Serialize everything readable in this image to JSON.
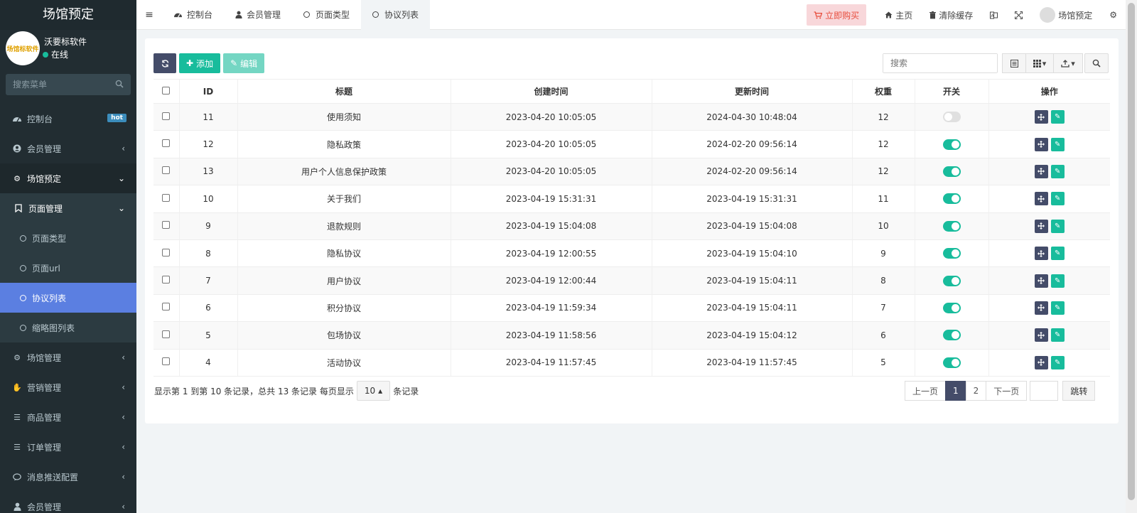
{
  "sidebar": {
    "brand": "场馆预定",
    "user": {
      "name": "沃要标软件",
      "status": "在线",
      "avatar_text": "场馆标软件"
    },
    "search_placeholder": "搜索菜单",
    "items": [
      {
        "label": "控制台",
        "icon": "dashboard-icon",
        "badge": "hot"
      },
      {
        "label": "会员管理",
        "icon": "user-circle-icon"
      },
      {
        "label": "场馆预定",
        "icon": "gear-icon"
      },
      {
        "label": "页面管理",
        "icon": "bookmark-icon"
      },
      {
        "label": "页面类型"
      },
      {
        "label": "页面url"
      },
      {
        "label": "协议列表"
      },
      {
        "label": "缩略图列表"
      },
      {
        "label": "场馆管理",
        "icon": "gear-icon"
      },
      {
        "label": "营销管理",
        "icon": "hand-icon"
      },
      {
        "label": "商品管理",
        "icon": "list-icon"
      },
      {
        "label": "订单管理",
        "icon": "list-icon"
      },
      {
        "label": "消息推送配置",
        "icon": "comment-icon"
      },
      {
        "label": "会员管理",
        "icon": "user-icon"
      }
    ]
  },
  "topbar": {
    "tabs": [
      {
        "label": "控制台"
      },
      {
        "label": "会员管理"
      },
      {
        "label": "页面类型"
      },
      {
        "label": "协议列表"
      }
    ],
    "buy": "立即购买",
    "home": "主页",
    "clear_cache": "清除缓存",
    "user": "场馆预定"
  },
  "toolbar": {
    "add": "添加",
    "edit": "编辑",
    "search_placeholder": "搜索"
  },
  "table": {
    "columns": [
      "ID",
      "标题",
      "创建时间",
      "更新时间",
      "权重",
      "开关",
      "操作"
    ],
    "rows": [
      {
        "id": "11",
        "title": "使用须知",
        "created": "2023-04-20 10:05:05",
        "updated": "2024-04-30 10:48:04",
        "weight": "12",
        "on": false
      },
      {
        "id": "12",
        "title": "隐私政策",
        "created": "2023-04-20 10:05:05",
        "updated": "2024-02-20 09:56:14",
        "weight": "12",
        "on": true
      },
      {
        "id": "13",
        "title": "用户个人信息保护政策",
        "created": "2023-04-20 10:05:05",
        "updated": "2024-02-20 09:56:14",
        "weight": "12",
        "on": true
      },
      {
        "id": "10",
        "title": "关于我们",
        "created": "2023-04-19 15:31:31",
        "updated": "2023-04-19 15:31:31",
        "weight": "11",
        "on": true
      },
      {
        "id": "9",
        "title": "退款规则",
        "created": "2023-04-19 15:04:08",
        "updated": "2023-04-19 15:04:08",
        "weight": "10",
        "on": true
      },
      {
        "id": "8",
        "title": "隐私协议",
        "created": "2023-04-19 12:00:55",
        "updated": "2023-04-19 15:04:10",
        "weight": "9",
        "on": true
      },
      {
        "id": "7",
        "title": "用户协议",
        "created": "2023-04-19 12:00:44",
        "updated": "2023-04-19 15:04:11",
        "weight": "8",
        "on": true
      },
      {
        "id": "6",
        "title": "积分协议",
        "created": "2023-04-19 11:59:34",
        "updated": "2023-04-19 15:04:11",
        "weight": "7",
        "on": true
      },
      {
        "id": "5",
        "title": "包场协议",
        "created": "2023-04-19 11:58:56",
        "updated": "2023-04-19 15:04:12",
        "weight": "6",
        "on": true
      },
      {
        "id": "4",
        "title": "活动协议",
        "created": "2023-04-19 11:57:45",
        "updated": "2023-04-19 11:57:45",
        "weight": "5",
        "on": true
      }
    ]
  },
  "footer": {
    "info_prefix": "显示第 1 到第 10 条记录，总共 13 条记录 每页显示",
    "page_size": "10",
    "info_suffix": "条记录",
    "prev": "上一页",
    "pages": [
      "1",
      "2"
    ],
    "next": "下一页",
    "jump": "跳转"
  },
  "colors": {
    "sidebar_bg": "#222d32",
    "active_item": "#5b7fe1",
    "success": "#18bc9c",
    "primary_dark": "#444c69",
    "buy_bg": "#f8d7da"
  }
}
